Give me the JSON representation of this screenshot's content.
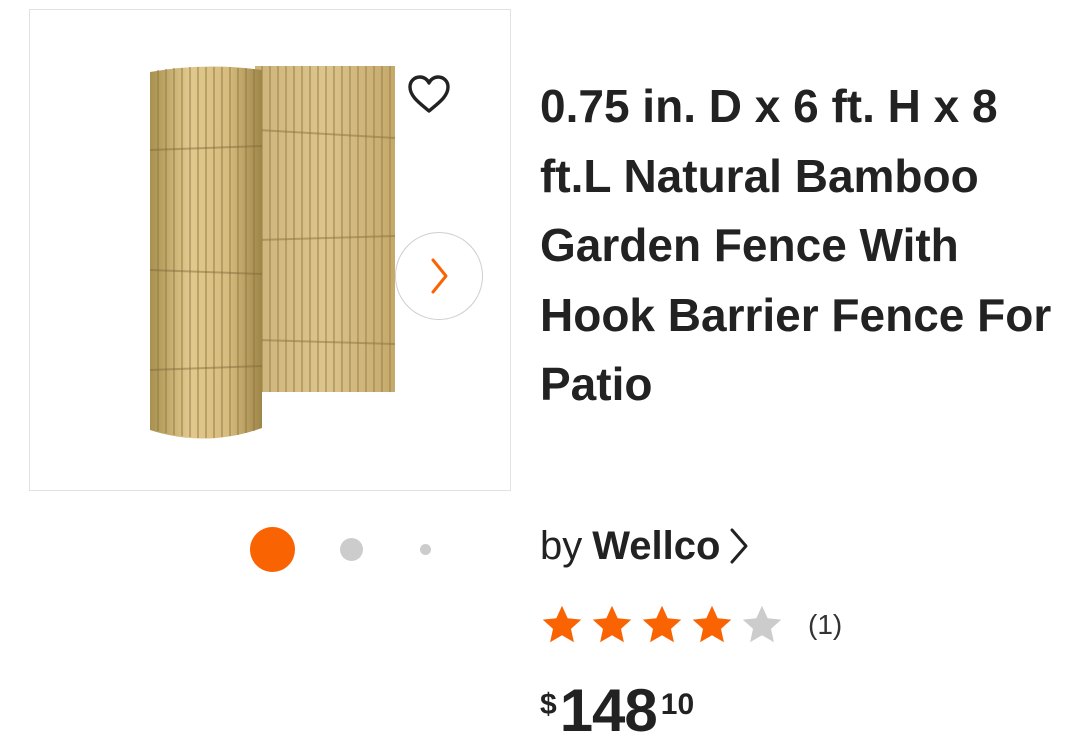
{
  "product": {
    "title": "0.75 in. D x 6 ft. H x 8 ft.L Natural Bamboo Garden Fence With Hook Barrier Fence For Patio",
    "brand_prefix": "by",
    "brand": "Wellco",
    "rating": {
      "stars": 4,
      "max": 5,
      "review_count": "(1)"
    },
    "price": {
      "symbol": "$",
      "dollars": "148",
      "cents": "10"
    }
  },
  "gallery": {
    "total_images": 3,
    "active_index": 0
  },
  "icons": {
    "favorite": "heart-outline-icon",
    "next": "chevron-right-icon",
    "brand_link": "chevron-right-icon",
    "rating": "star-icon"
  },
  "colors": {
    "accent": "#f96302",
    "star_filled": "#f96302",
    "star_empty": "#cccccc",
    "dot_inactive": "#cccccc",
    "text": "#222222"
  }
}
